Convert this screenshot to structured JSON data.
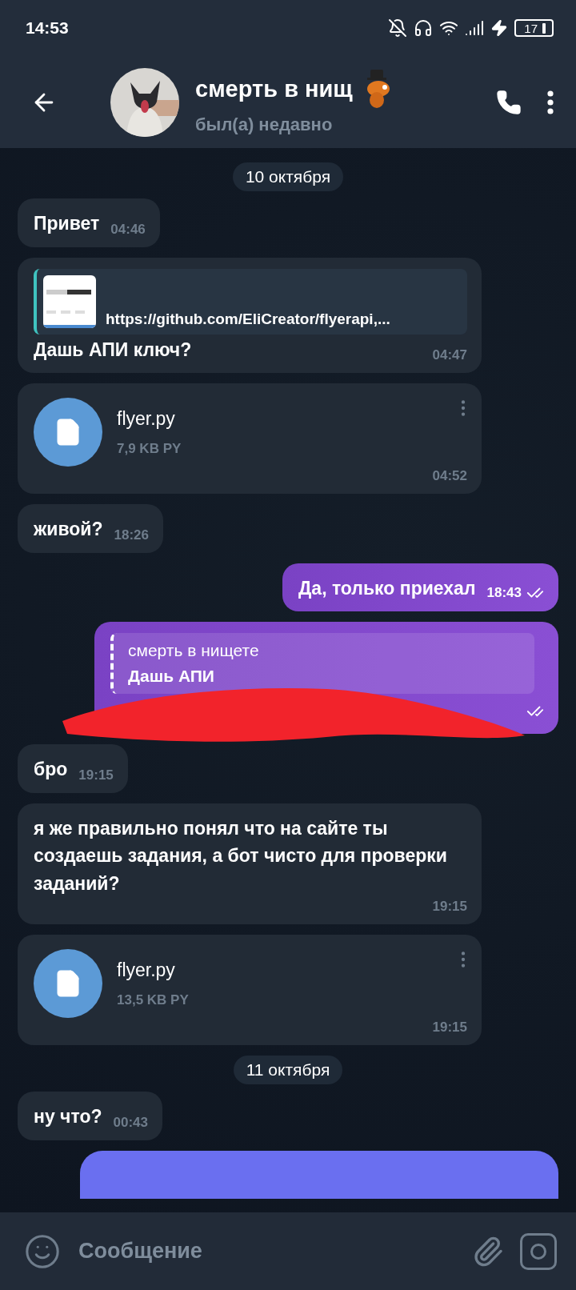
{
  "status_bar": {
    "time": "14:53",
    "battery": "17"
  },
  "header": {
    "name": "смерть в нищ",
    "status": "был(а) недавно"
  },
  "messages": [
    {
      "kind": "date",
      "text": "10 октября"
    },
    {
      "kind": "text",
      "outgoing": false,
      "text": "Привет",
      "time": "04:46"
    },
    {
      "kind": "link",
      "outgoing": false,
      "url": "https://github.com/EliCreator/flyerapi,...",
      "text": "Дашь АПИ ключ?",
      "time": "04:47"
    },
    {
      "kind": "file",
      "outgoing": false,
      "name": "flyer.py",
      "size": "7,9 KB PY",
      "time": "04:52"
    },
    {
      "kind": "text",
      "outgoing": false,
      "text": "живой?",
      "time": "18:26"
    },
    {
      "kind": "text",
      "outgoing": true,
      "text": "Да, только приехал",
      "time": "18:43",
      "read": true
    },
    {
      "kind": "reply",
      "outgoing": true,
      "quote_author": "смерть в нищете",
      "quote_text": "Дашь АПИ",
      "read": true,
      "redacted": true
    },
    {
      "kind": "text",
      "outgoing": false,
      "text": "бро",
      "time": "19:15"
    },
    {
      "kind": "text",
      "outgoing": false,
      "text": "я же правильно понял что на сайте ты создаешь задания, а бот чисто для проверки заданий?",
      "time": "19:15"
    },
    {
      "kind": "file",
      "outgoing": false,
      "name": "flyer.py",
      "size": "13,5 KB PY",
      "time": "19:15"
    },
    {
      "kind": "date",
      "text": "11 октября"
    },
    {
      "kind": "text",
      "outgoing": false,
      "text": "ну что?",
      "time": "00:43"
    },
    {
      "kind": "partial",
      "outgoing": true
    }
  ],
  "composer": {
    "placeholder": "Сообщение"
  }
}
